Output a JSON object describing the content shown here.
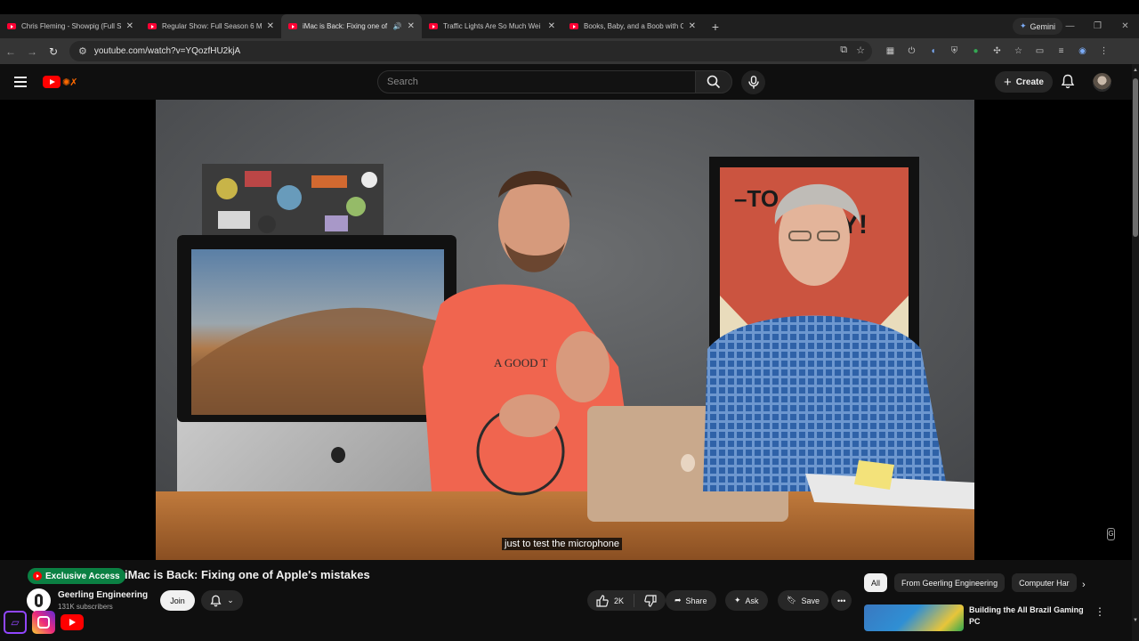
{
  "browser": {
    "tabs": [
      {
        "title": "Chris Fleming - Showpig (Full S",
        "active": false,
        "audio": false
      },
      {
        "title": "Regular Show: Full Season 6 M",
        "active": false,
        "audio": false
      },
      {
        "title": "iMac is Back: Fixing one of",
        "active": true,
        "audio": true
      },
      {
        "title": "Traffic Lights Are So Much Wei",
        "active": false,
        "audio": false
      },
      {
        "title": "Books, Baby, and a Boob with C",
        "active": false,
        "audio": false
      }
    ],
    "gemini_label": "Gemini",
    "url": "youtube.com/watch?v=YQozfHU2kjA"
  },
  "youtube": {
    "search_placeholder": "Search",
    "create_label": "Create"
  },
  "video": {
    "caption": "just to test the microphone",
    "badge": "Exclusive Access",
    "title": "iMac is Back: Fixing one of Apple's mistakes",
    "channel": "Geerling Engineering",
    "subscribers": "131K subscribers",
    "join_label": "Join",
    "likes": "2K",
    "share_label": "Share",
    "ask_label": "Ask",
    "save_label": "Save"
  },
  "sidebar": {
    "chips": [
      "All",
      "From Geerling Engineering",
      "Computer Har"
    ],
    "recommendation": {
      "title": "Building the All Brazil Gaming PC"
    }
  },
  "colors": {
    "accent": "#ff0000",
    "badge": "#0b8043",
    "twitch": "#9146ff"
  }
}
